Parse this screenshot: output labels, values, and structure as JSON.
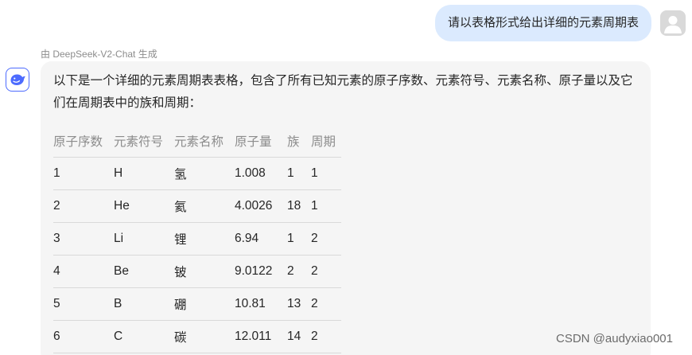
{
  "user_message": "请以表格形式给出详细的元素周期表",
  "model_label": "由 DeepSeek-V2-Chat 生成",
  "bot": {
    "intro": "以下是一个详细的元素周期表表格，包含了所有已知元素的原子序数、元素符号、元素名称、原子量以及它们在周期表中的族和周期："
  },
  "table": {
    "headers": [
      "原子序数",
      "元素符号",
      "元素名称",
      "原子量",
      "族",
      "周期"
    ],
    "rows": [
      [
        "1",
        "H",
        "氢",
        "1.008",
        "1",
        "1"
      ],
      [
        "2",
        "He",
        "氦",
        "4.0026",
        "18",
        "1"
      ],
      [
        "3",
        "Li",
        "锂",
        "6.94",
        "1",
        "2"
      ],
      [
        "4",
        "Be",
        "铍",
        "9.0122",
        "2",
        "2"
      ],
      [
        "5",
        "B",
        "硼",
        "10.81",
        "13",
        "2"
      ],
      [
        "6",
        "C",
        "碳",
        "12.011",
        "14",
        "2"
      ]
    ]
  },
  "watermark": "CSDN @audyxiao001",
  "icons": {
    "user_avatar": "user-avatar-icon",
    "bot_avatar": "deepseek-whale-icon"
  },
  "colors": {
    "user_bubble": "#dbeafe",
    "bot_bubble": "#f5f5f5",
    "brand": "#4d6bfe"
  }
}
